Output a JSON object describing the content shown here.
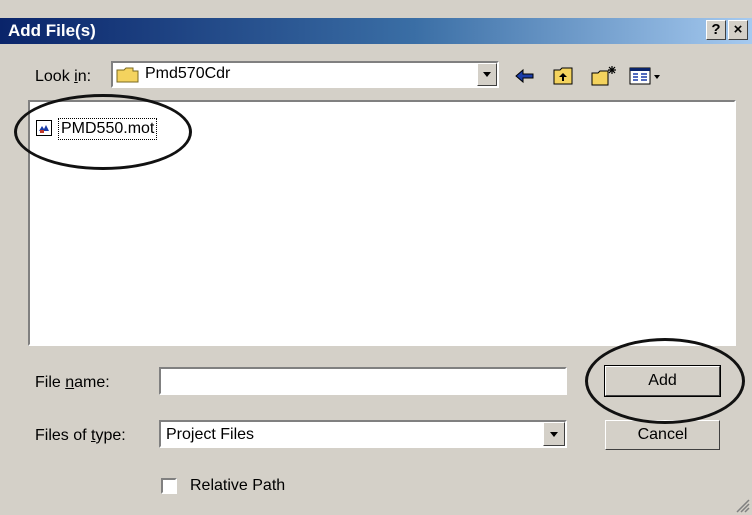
{
  "window": {
    "title": "Add File(s)",
    "help_label": "?",
    "close_label": "×"
  },
  "lookin": {
    "label_pre": "Look ",
    "label_key": "i",
    "label_post": "n:",
    "value": "Pmd570Cdr"
  },
  "toolbar": {
    "back_icon": "back-arrow-icon",
    "up_icon": "up-folder-icon",
    "new_folder_icon": "new-folder-icon",
    "view_icon": "view-menu-icon"
  },
  "files": [
    {
      "name": "PMD550.mot",
      "icon": "mot-file-icon"
    }
  ],
  "filename": {
    "label_pre": "File ",
    "label_key": "n",
    "label_post": "ame:",
    "value": ""
  },
  "filetype": {
    "label_pre": "Files of ",
    "label_key": "t",
    "label_post": "ype:",
    "value": "Project Files"
  },
  "buttons": {
    "add": "Add",
    "cancel": "Cancel"
  },
  "relative_path": {
    "label": "Relative Path",
    "checked": false
  },
  "colors": {
    "title_start": "#0a246a",
    "title_end": "#a6caf0",
    "face": "#d4d0c8"
  }
}
